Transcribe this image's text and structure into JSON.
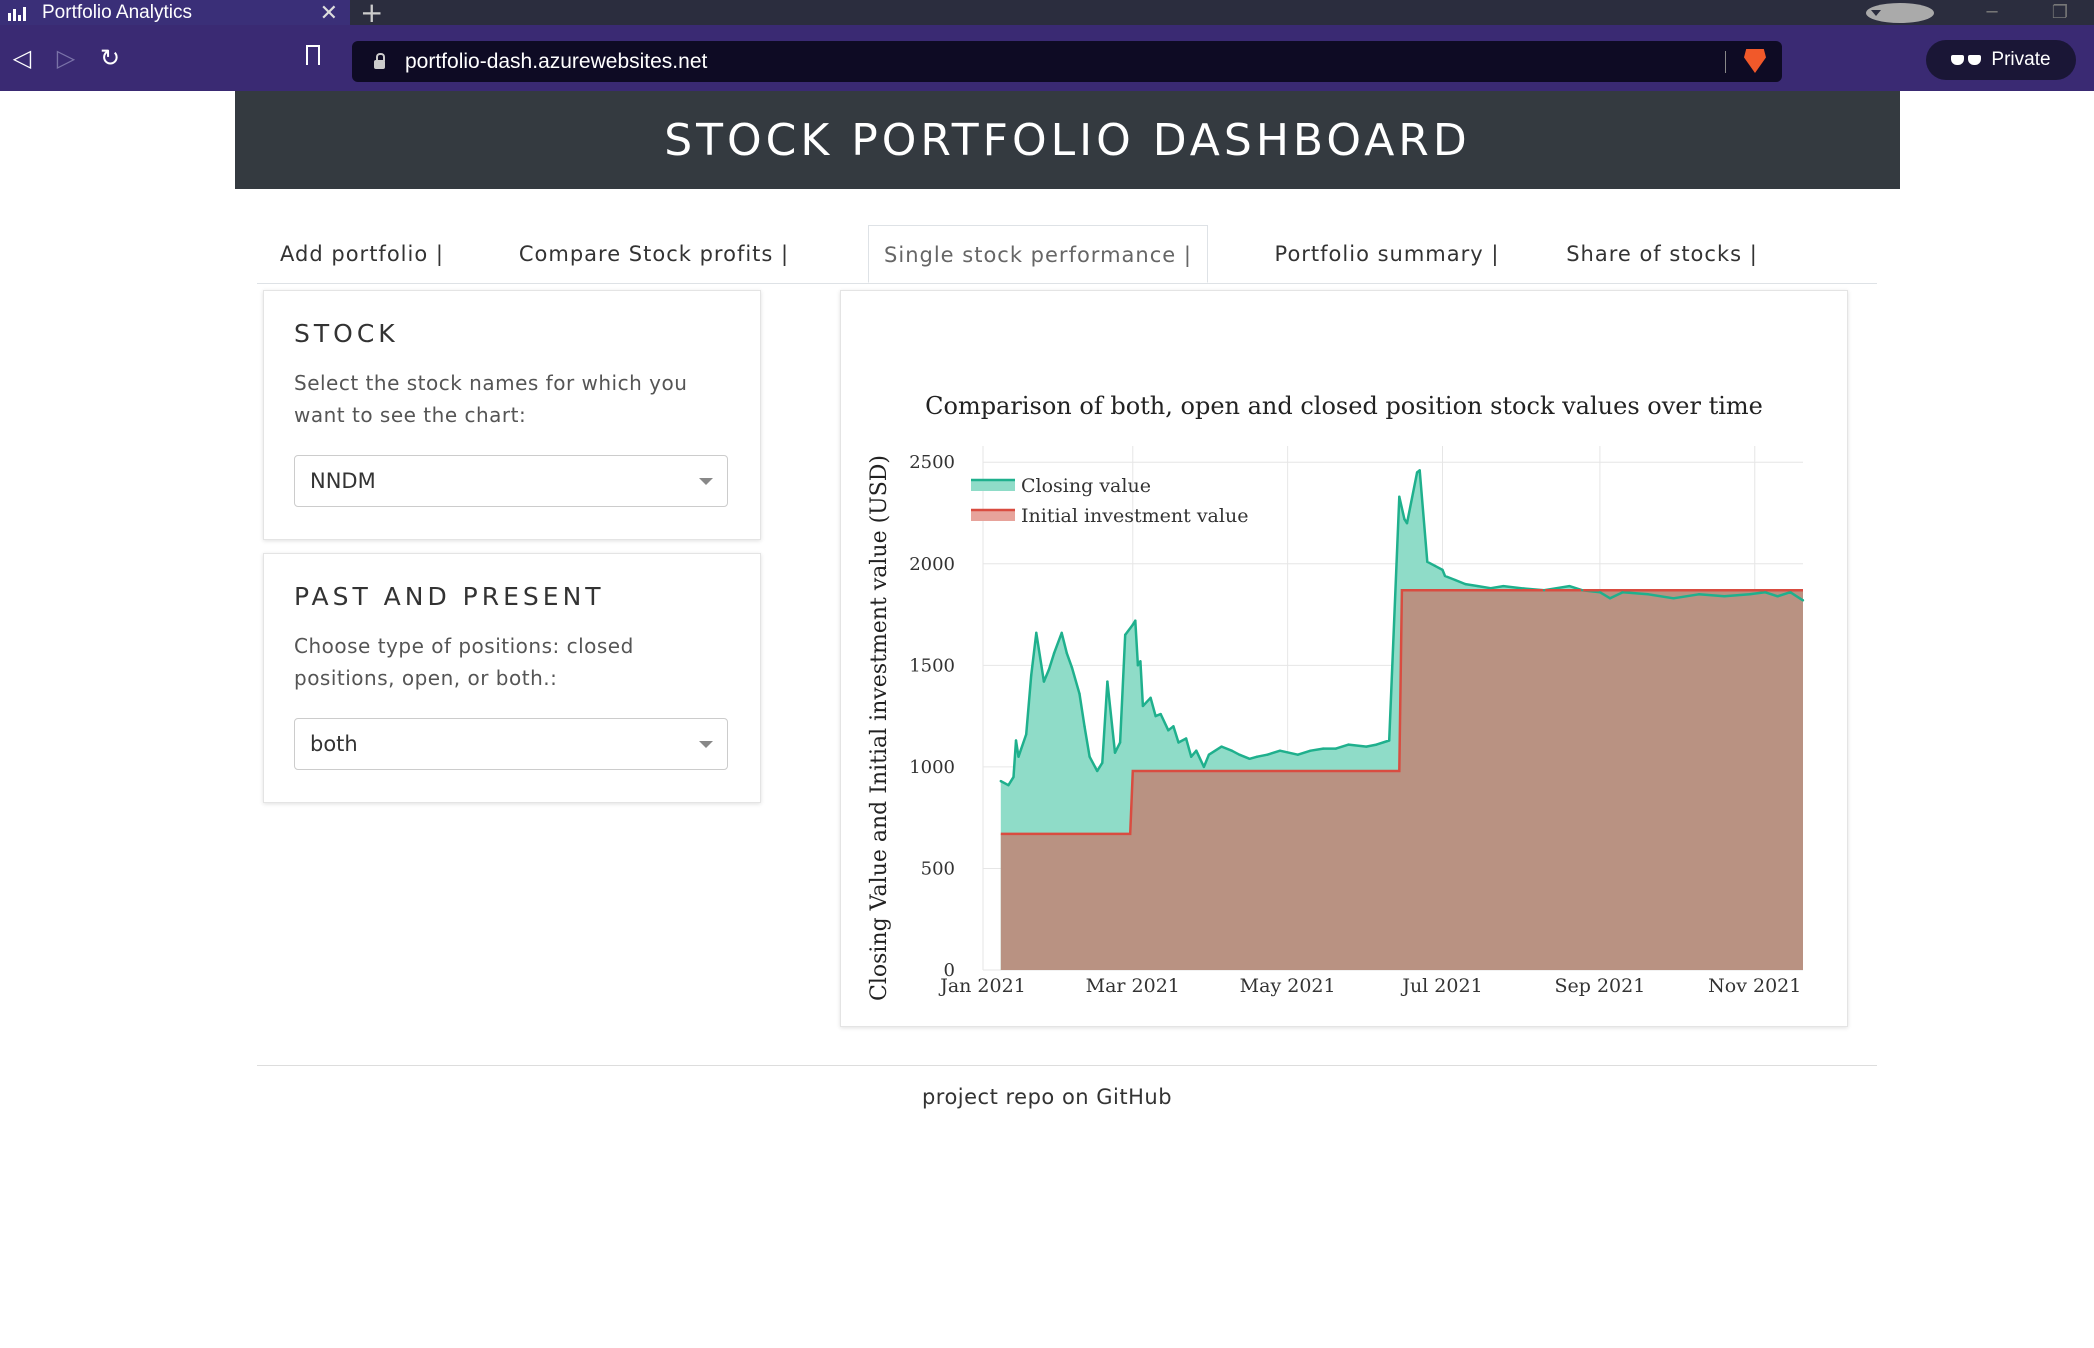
{
  "browser": {
    "tab_title": "Portfolio Analytics",
    "new_tab_symbol": "+",
    "close_symbol": "✕",
    "url": "portfolio-dash.azurewebsites.net",
    "private_label": "Private"
  },
  "page": {
    "header_title": "STOCK PORTFOLIO DASHBOARD",
    "tabs": [
      {
        "label": "Add portfolio |"
      },
      {
        "label": "Compare Stock profits |"
      },
      {
        "label": "Single stock performance |"
      },
      {
        "label": "Portfolio summary |"
      },
      {
        "label": "Share of stocks |"
      }
    ],
    "active_tab": "Single stock performance |",
    "stock_card": {
      "title": "STOCK",
      "description": "Select the stock names for which you want to see the chart:",
      "selected": "NNDM"
    },
    "positions_card": {
      "title": "PAST AND PRESENT",
      "description": "Choose type of positions: closed positions, open, or both.:",
      "selected": "both"
    },
    "footer_link": "project repo on GitHub"
  },
  "colors": {
    "closing_fill": "#8fdcc8",
    "closing_line": "#1fb08d",
    "initial_fill": "#b99282",
    "initial_line": "#d94c40",
    "header_bg": "#343a40",
    "browser_bar": "#3a2a73"
  },
  "chart_data": {
    "type": "area",
    "title": "Comparison of both, open and closed position stock values over time",
    "xlabel": "",
    "ylabel": "Closing Value and Initial investment value (USD)",
    "x_ticks": [
      "Jan 2021",
      "Mar 2021",
      "May 2021",
      "Jul 2021",
      "Sep 2021",
      "Nov 2021"
    ],
    "y_ticks": [
      0,
      500,
      1000,
      1500,
      2000,
      2500
    ],
    "ylim": [
      0,
      2580
    ],
    "xlim": [
      "2021-01-01",
      "2021-11-20"
    ],
    "legend_position": "top-left",
    "grid": true,
    "series": [
      {
        "name": "Closing value",
        "x": [
          "2021-01-08",
          "2021-01-11",
          "2021-01-13",
          "2021-01-14",
          "2021-01-15",
          "2021-01-18",
          "2021-01-20",
          "2021-01-22",
          "2021-01-25",
          "2021-01-27",
          "2021-01-29",
          "2021-02-01",
          "2021-02-03",
          "2021-02-05",
          "2021-02-08",
          "2021-02-10",
          "2021-02-12",
          "2021-02-15",
          "2021-02-17",
          "2021-02-19",
          "2021-02-22",
          "2021-02-24",
          "2021-02-26",
          "2021-03-01",
          "2021-03-02",
          "2021-03-03",
          "2021-03-04",
          "2021-03-05",
          "2021-03-08",
          "2021-03-10",
          "2021-03-12",
          "2021-03-15",
          "2021-03-17",
          "2021-03-19",
          "2021-03-22",
          "2021-03-24",
          "2021-03-26",
          "2021-03-29",
          "2021-03-31",
          "2021-04-05",
          "2021-04-09",
          "2021-04-12",
          "2021-04-16",
          "2021-04-19",
          "2021-04-23",
          "2021-04-28",
          "2021-05-05",
          "2021-05-10",
          "2021-05-15",
          "2021-05-20",
          "2021-05-25",
          "2021-06-01",
          "2021-06-05",
          "2021-06-10",
          "2021-06-14",
          "2021-06-16",
          "2021-06-17",
          "2021-06-21",
          "2021-06-22",
          "2021-06-25",
          "2021-06-28",
          "2021-07-01",
          "2021-07-02",
          "2021-07-06",
          "2021-07-10",
          "2021-07-15",
          "2021-07-20",
          "2021-07-25",
          "2021-08-01",
          "2021-08-10",
          "2021-08-20",
          "2021-08-25",
          "2021-09-01",
          "2021-09-05",
          "2021-09-10",
          "2021-09-20",
          "2021-09-30",
          "2021-10-10",
          "2021-10-20",
          "2021-10-30",
          "2021-11-05",
          "2021-11-10",
          "2021-11-15",
          "2021-11-20"
        ],
        "values": [
          930,
          910,
          950,
          1130,
          1050,
          1160,
          1450,
          1660,
          1420,
          1480,
          1560,
          1660,
          1560,
          1490,
          1360,
          1200,
          1050,
          980,
          1020,
          1420,
          1070,
          1120,
          1650,
          1700,
          1720,
          1500,
          1520,
          1300,
          1340,
          1250,
          1260,
          1180,
          1200,
          1120,
          1140,
          1050,
          1080,
          1000,
          1060,
          1100,
          1080,
          1060,
          1040,
          1050,
          1060,
          1080,
          1060,
          1080,
          1090,
          1090,
          1110,
          1100,
          1110,
          1130,
          2330,
          2220,
          2200,
          2450,
          2460,
          2010,
          1990,
          1970,
          1940,
          1920,
          1900,
          1890,
          1880,
          1890,
          1880,
          1870,
          1890,
          1870,
          1860,
          1830,
          1860,
          1850,
          1830,
          1850,
          1840,
          1850,
          1860,
          1840,
          1860,
          1820
        ]
      },
      {
        "name": "Initial investment value",
        "x": [
          "2021-01-08",
          "2021-02-28",
          "2021-03-01",
          "2021-06-14",
          "2021-06-15",
          "2021-11-20"
        ],
        "values": [
          670,
          670,
          980,
          980,
          1870,
          1870
        ]
      }
    ]
  }
}
